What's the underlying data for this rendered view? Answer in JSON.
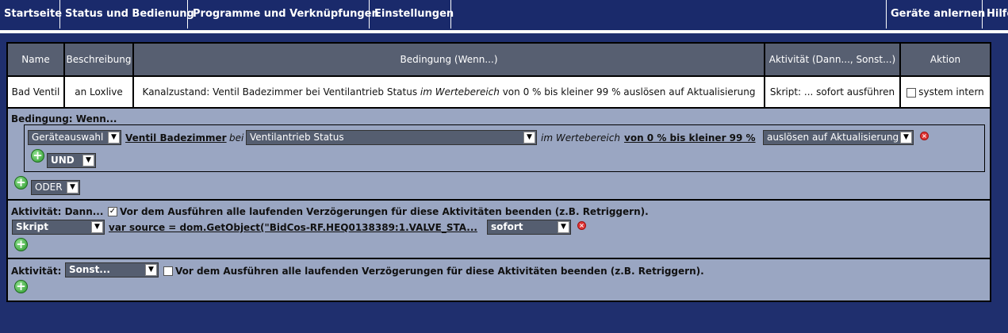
{
  "nav": {
    "home": "Startseite",
    "status": "Status und Bedienung",
    "programs": "Programme und Verknüpfungen",
    "settings": "Einstellungen",
    "teach": "Geräte anlernen",
    "help": "Hilfe"
  },
  "table": {
    "headers": [
      "Name",
      "Beschreibung",
      "Bedingung (Wenn...)",
      "Aktivität (Dann..., Sonst...)",
      "Aktion"
    ],
    "row": {
      "name": "Bad Ventil",
      "description": "an Loxlive",
      "condition_a": "Kanalzustand: Ventil Badezimmer bei Ventilantrieb Status ",
      "condition_b": "im Wertebereich",
      "condition_c": " von 0 % bis kleiner 99 % auslösen auf Aktualisierung",
      "activity": "Skript: ... sofort ausführen",
      "action": "system intern"
    }
  },
  "condition": {
    "title": "Bedingung: Wenn...",
    "device_select": "Geräteauswahl",
    "device_link": "Ventil Badezimmer",
    "at": "bei",
    "param_select": "Ventilantrieb Status",
    "range_text": "im Wertebereich",
    "range_link": "von 0 % bis kleiner 99 %",
    "trigger_select": "auslösen auf Aktualisierung",
    "and_select": "UND",
    "or_select": "ODER"
  },
  "then": {
    "title": "Aktivität: Dann...",
    "checkbox_checked": true,
    "checkbox_label": "Vor dem Ausführen alle laufenden Verzögerungen für diese Aktivitäten beenden (z.B. Retriggern).",
    "type_select": "Skript",
    "script_link": "var source = dom.GetObject(\"BidCos-RF.HEQ0138389:1.VALVE_STA...",
    "timing_select": "sofort"
  },
  "else": {
    "title": "Aktivität:",
    "select": "Sonst...",
    "checkbox_checked": false,
    "checkbox_label": "Vor dem Ausführen alle laufenden Verzögerungen für diese Aktivitäten beenden (z.B. Retriggern)."
  },
  "icons": {
    "dropdown_arrow": "▼",
    "check": "✓",
    "plus": "+",
    "close": "×"
  }
}
